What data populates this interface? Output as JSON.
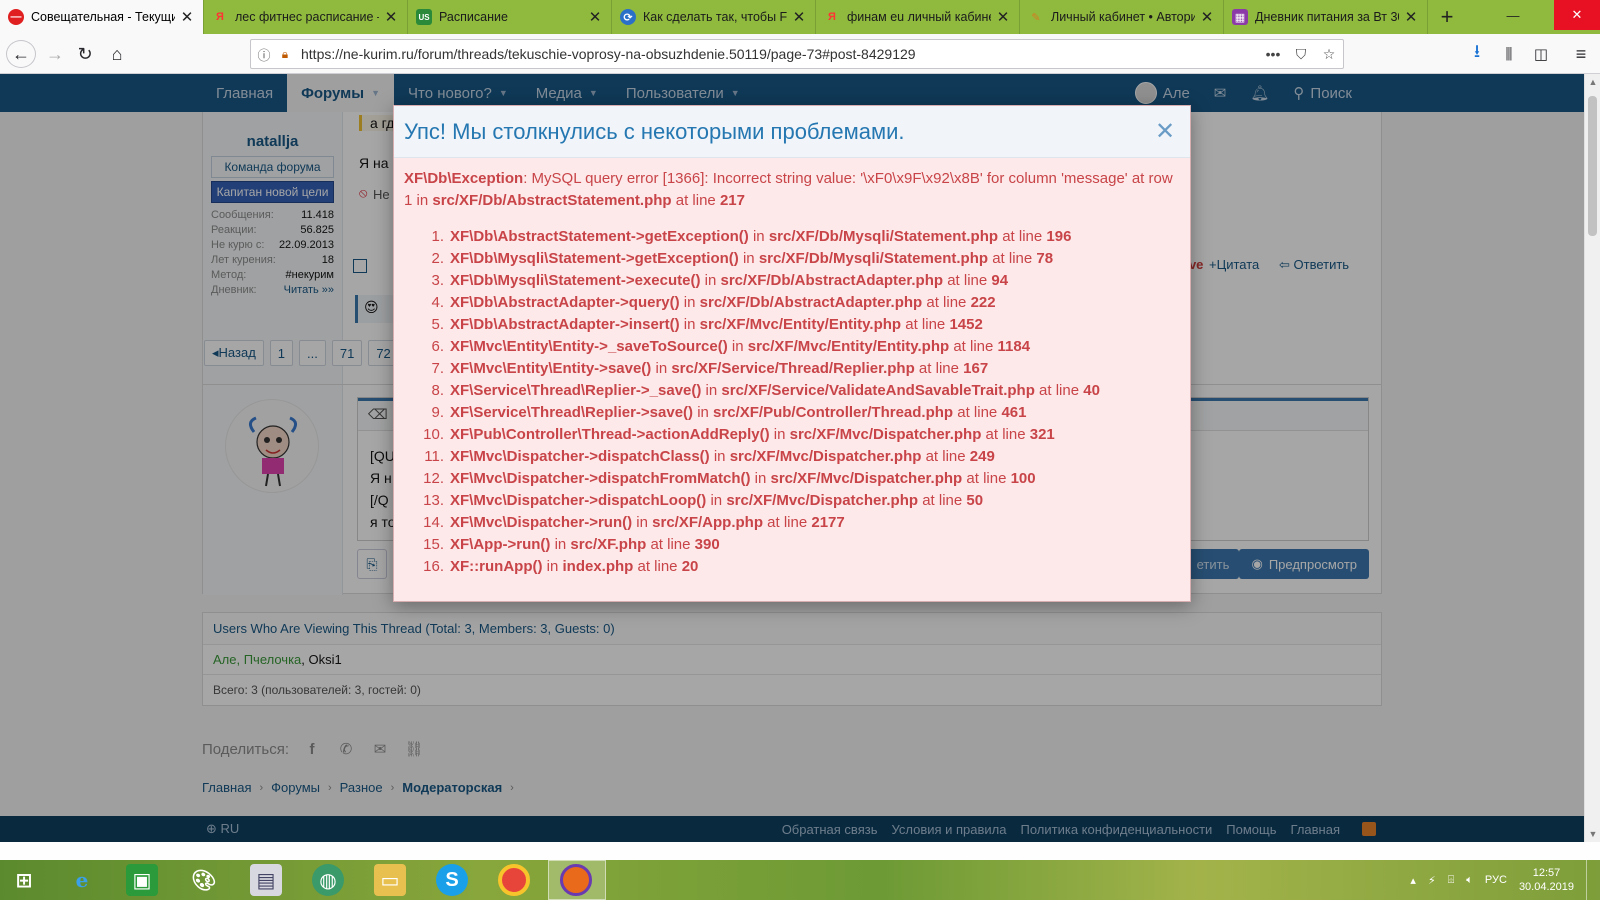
{
  "browser": {
    "tabs": [
      {
        "title": "Совещательная - Текущие",
        "icon_color": "#e02020",
        "icon": "circle-icon"
      },
      {
        "title": "лес фитнес расписание —",
        "icon_color": "#ff3333",
        "icon": "yandex-icon"
      },
      {
        "title": "Расписание",
        "icon_color": "#2a8a3a",
        "icon": "app-icon"
      },
      {
        "title": "Как сделать так, чтобы Fir",
        "icon_color": "#2a70c8",
        "icon": "site-icon"
      },
      {
        "title": "финам eu личный кабинет",
        "icon_color": "#ff3333",
        "icon": "yandex-icon"
      },
      {
        "title": "Личный кабинет • Автори",
        "icon_color": "#d87a20",
        "icon": "site-icon"
      },
      {
        "title": "Дневник питания за Вт 30",
        "icon_color": "#8c3aa8",
        "icon": "site-icon"
      }
    ],
    "url": "https://ne-kurim.ru/forum/threads/tekuschie-voprosy-na-obsuzhdenie.50119/page-73#post-8429129"
  },
  "forum_nav": {
    "items": [
      {
        "label": "Главная"
      },
      {
        "label": "Форумы"
      },
      {
        "label": "Что нового?"
      },
      {
        "label": "Медиа"
      },
      {
        "label": "Пользователи"
      }
    ],
    "user": "Але",
    "search": "Поиск"
  },
  "post": {
    "username": "natallja",
    "badge1": "Команда форума",
    "badge2": "Капитан новой цели",
    "stats": [
      {
        "k": "Сообщения:",
        "v": "11.418"
      },
      {
        "k": "Реакции:",
        "v": "56.825"
      },
      {
        "k": "Не курю с:",
        "v": "22.09.2013"
      },
      {
        "k": "Лет курения:",
        "v": "18"
      },
      {
        "k": "Метод:",
        "v": "#некурим"
      },
      {
        "k": "Дневник:",
        "v": "Читать »»"
      }
    ],
    "frag_quote": "а гд",
    "frag_text": "Я на",
    "frag_not": "Не",
    "love": "ove",
    "quote_action": "+Цитата",
    "reply_action": "Ответить"
  },
  "pager": {
    "prev": "◂Назад",
    "pages": [
      "1",
      "...",
      "71",
      "72",
      "7"
    ]
  },
  "reply": {
    "lines": [
      "[QU",
      "Я н",
      "[/Q",
      "я то"
    ],
    "preview": "Предпросмотр",
    "reply_btn": "етить",
    "attach": "П"
  },
  "viewers": {
    "header": "Users Who Are Viewing This Thread (Total: 3, Members: 3, Guests: 0)",
    "names_green": "Але, Пчелочка",
    "names_rest": ", Oksi1",
    "footer": "Всего: 3 (пользователей: 3, гостей: 0)"
  },
  "share": {
    "label": "Поделиться:"
  },
  "breadcrumbs": [
    "Главная",
    "Форумы",
    "Разное",
    "Модераторская"
  ],
  "footer": {
    "lang": "RU",
    "links": [
      "Обратная связь",
      "Условия и правила",
      "Политика конфиденциальности",
      "Помощь",
      "Главная"
    ]
  },
  "error": {
    "title": "Упс! Мы столкнулись с некоторыми проблемами.",
    "exception_class": "XF\\Db\\Exception",
    "message": ": MySQL query error [1366]: Incorrect string value: '\\xF0\\x9F\\x92\\x8B' for column 'message' at row 1 in ",
    "file": "src/XF/Db/AbstractStatement.php",
    "at_line_text": " at line ",
    "line": "217",
    "trace": [
      {
        "fn": "XF\\Db\\AbstractStatement->getException()",
        "file": "src/XF/Db/Mysqli/Statement.php",
        "line": "196"
      },
      {
        "fn": "XF\\Db\\Mysqli\\Statement->getException()",
        "file": "src/XF/Db/Mysqli/Statement.php",
        "line": "78"
      },
      {
        "fn": "XF\\Db\\Mysqli\\Statement->execute()",
        "file": "src/XF/Db/AbstractAdapter.php",
        "line": "94"
      },
      {
        "fn": "XF\\Db\\AbstractAdapter->query()",
        "file": "src/XF/Db/AbstractAdapter.php",
        "line": "222"
      },
      {
        "fn": "XF\\Db\\AbstractAdapter->insert()",
        "file": "src/XF/Mvc/Entity/Entity.php",
        "line": "1452"
      },
      {
        "fn": "XF\\Mvc\\Entity\\Entity->_saveToSource()",
        "file": "src/XF/Mvc/Entity/Entity.php",
        "line": "1184"
      },
      {
        "fn": "XF\\Mvc\\Entity\\Entity->save()",
        "file": "src/XF/Service/Thread/Replier.php",
        "line": "167"
      },
      {
        "fn": "XF\\Service\\Thread\\Replier->_save()",
        "file": "src/XF/Service/ValidateAndSavableTrait.php",
        "line": "40"
      },
      {
        "fn": "XF\\Service\\Thread\\Replier->save()",
        "file": "src/XF/Pub/Controller/Thread.php",
        "line": "461"
      },
      {
        "fn": "XF\\Pub\\Controller\\Thread->actionAddReply()",
        "file": "src/XF/Mvc/Dispatcher.php",
        "line": "321"
      },
      {
        "fn": "XF\\Mvc\\Dispatcher->dispatchClass()",
        "file": "src/XF/Mvc/Dispatcher.php",
        "line": "249"
      },
      {
        "fn": "XF\\Mvc\\Dispatcher->dispatchFromMatch()",
        "file": "src/XF/Mvc/Dispatcher.php",
        "line": "100"
      },
      {
        "fn": "XF\\Mvc\\Dispatcher->dispatchLoop()",
        "file": "src/XF/Mvc/Dispatcher.php",
        "line": "50"
      },
      {
        "fn": "XF\\Mvc\\Dispatcher->run()",
        "file": "src/XF/App.php",
        "line": "2177"
      },
      {
        "fn": "XF\\App->run()",
        "file": "src/XF.php",
        "line": "390"
      },
      {
        "fn": "XF::runApp()",
        "file": "index.php",
        "line": "20"
      }
    ],
    "in_text": " in "
  },
  "taskbar": {
    "lang": "РУС",
    "time": "12:57",
    "date": "30.04.2019"
  },
  "colors": {
    "forum_nav": "#185886",
    "error_text": "#c84448",
    "error_bg": "#fde9e9",
    "title_blue": "#2577b1"
  }
}
